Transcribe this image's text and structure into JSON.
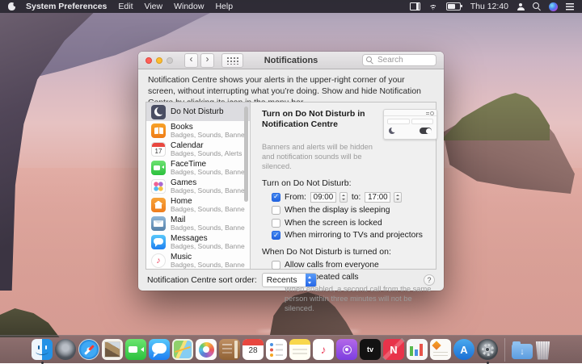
{
  "colors": {
    "accent": "#2a6de8",
    "menubar_bg": "#26242c",
    "window_bg": "#ececec"
  },
  "menu_bar": {
    "items": [
      "System Preferences",
      "Edit",
      "View",
      "Window",
      "Help"
    ],
    "clock": "Thu 12:40"
  },
  "window": {
    "title": "Notifications",
    "search_placeholder": "Search",
    "description": "Notification Centre shows your alerts in the upper-right corner of your screen, without interrupting what you’re doing. Show and hide Notification Centre by clicking its icon in the menu bar.",
    "sidebar": {
      "items": [
        {
          "name": "Do Not Disturb",
          "subtitle": ""
        },
        {
          "name": "Books",
          "subtitle": "Badges, Sounds, Banners"
        },
        {
          "name": "Calendar",
          "subtitle": "Badges, Sounds, Alerts",
          "icon_day": "17"
        },
        {
          "name": "FaceTime",
          "subtitle": "Badges, Sounds, Banners"
        },
        {
          "name": "Games",
          "subtitle": "Badges, Sounds, Banners"
        },
        {
          "name": "Home",
          "subtitle": "Badges, Sounds, Banners"
        },
        {
          "name": "Mail",
          "subtitle": "Badges, Sounds, Banners"
        },
        {
          "name": "Messages",
          "subtitle": "Badges, Sounds, Banners"
        },
        {
          "name": "Music",
          "subtitle": "Badges, Sounds, Banners"
        }
      ]
    },
    "panel": {
      "turn_on_title": "Turn on Do Not Disturb in Notification Centre",
      "turn_on_note": "Banners and alerts will be hidden and notification sounds will be silenced.",
      "schedule_label": "Turn on Do Not Disturb:",
      "schedule": {
        "from_label": "From:",
        "from_time": "09:00",
        "to_label": "to:",
        "to_time": "17:00",
        "checked": true
      },
      "options": [
        {
          "label": "When the display is sleeping",
          "checked": false
        },
        {
          "label": "When the screen is locked",
          "checked": false
        },
        {
          "label": "When mirroring to TVs and projectors",
          "checked": true
        }
      ],
      "when_on_label": "When Do Not Disturb is turned on:",
      "call_options": [
        {
          "label": "Allow calls from everyone",
          "checked": false
        },
        {
          "label": "Allow repeated calls",
          "checked": true
        }
      ],
      "repeated_note": "When enabled, a second call from the same person within three minutes will not be silenced."
    },
    "footer": {
      "sort_label": "Notification Centre sort order:",
      "sort_value": "Recents",
      "help_label": "?"
    }
  },
  "dock": {
    "items": [
      "Finder",
      "Launchpad",
      "Safari",
      "Preview",
      "FaceTime",
      "Messages",
      "Maps",
      "Photos",
      "Contacts",
      "Calendar",
      "Reminders",
      "Notes",
      "Music",
      "Podcasts",
      "TV",
      "News",
      "Numbers",
      "Pages",
      "App Store",
      "System Preferences",
      "Downloads",
      "Trash"
    ],
    "calendar_day": "28",
    "tv_label": "tv",
    "news_letter": "N",
    "appstore_letter": "A"
  }
}
